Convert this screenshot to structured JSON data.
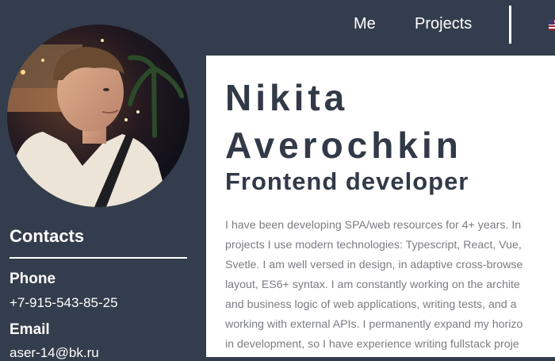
{
  "nav": {
    "items": [
      {
        "label": "Me"
      },
      {
        "label": "Projects"
      }
    ],
    "language_icon": "us-flag-icon"
  },
  "sidebar": {
    "avatar_icon": "profile-photo",
    "contacts_title": "Contacts",
    "phone_label": "Phone",
    "phone_value": "+7-915-543-85-25",
    "email_label": "Email",
    "email_value": "aser-14@bk.ru"
  },
  "profile": {
    "first_name": "Nikita",
    "last_name": "Averochkin",
    "role": "Frontend developer",
    "about_lines": [
      "I have been developing SPA/web resources for 4+ years. In",
      "projects I use modern technologies: Typescript, React, Vue,",
      "Svetle. I am well versed in design, in adaptive cross-browse",
      "layout, ES6+ syntax. I am constantly working on the archite",
      "and business logic of web applications, writing tests, and a",
      "working with external APIs. I permanently expand my horizo",
      "in development, so I have experience writing fullstack proje"
    ]
  },
  "colors": {
    "sidebar_bg": "#343d4d",
    "main_bg": "#ffffff",
    "heading": "#323a48",
    "body_text": "#7b7d82"
  }
}
